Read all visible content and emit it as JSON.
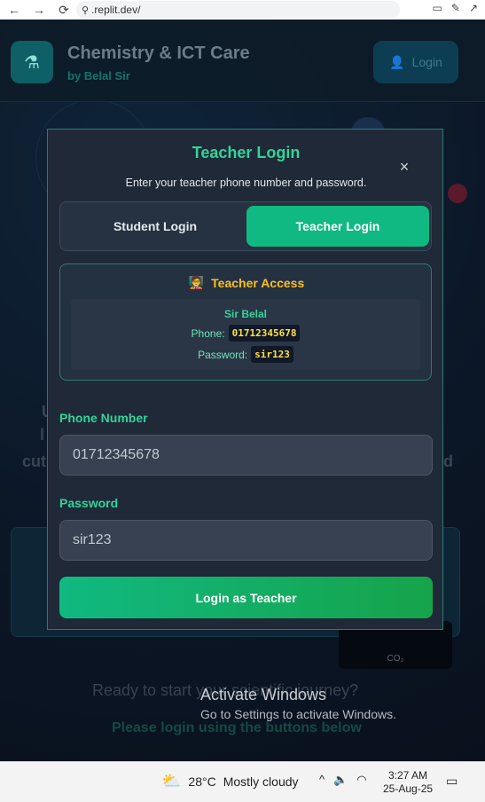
{
  "browser": {
    "url": ".replit.dev/"
  },
  "app": {
    "title": "Chemistry & ICT Care",
    "subtitle": "by Belal Sir",
    "header_login_label": "Login",
    "bg_ready": "Ready to start your scientific journey?",
    "bg_please": "Please login using the buttons below",
    "bg_co2": "CO₂"
  },
  "modal": {
    "title": "Teacher Login",
    "description": "Enter your teacher phone number and password.",
    "close_symbol": "×",
    "tabs": [
      {
        "label": "Student Login",
        "active": false
      },
      {
        "label": "Teacher Login",
        "active": true
      }
    ],
    "access": {
      "emoji": "🧑‍🏫",
      "title": "Teacher Access",
      "name": "Sir Belal",
      "phone_label": "Phone:",
      "phone_value": "01712345678",
      "password_label": "Password:",
      "password_value": "sir123"
    },
    "phone_label": "Phone Number",
    "phone_value": "01712345678",
    "password_label": "Password",
    "password_value": "sir123",
    "submit_label": "Login as Teacher"
  },
  "windows": {
    "activate_title": "Activate Windows",
    "activate_sub": "Go to Settings to activate Windows."
  },
  "taskbar": {
    "temperature": "28°C",
    "weather": "Mostly cloudy",
    "time": "3:27 AM",
    "date": "25-Aug-25"
  },
  "colors": {
    "accent": "#34d399",
    "tab_active": "#10b981",
    "access_title": "#fbbf24"
  }
}
